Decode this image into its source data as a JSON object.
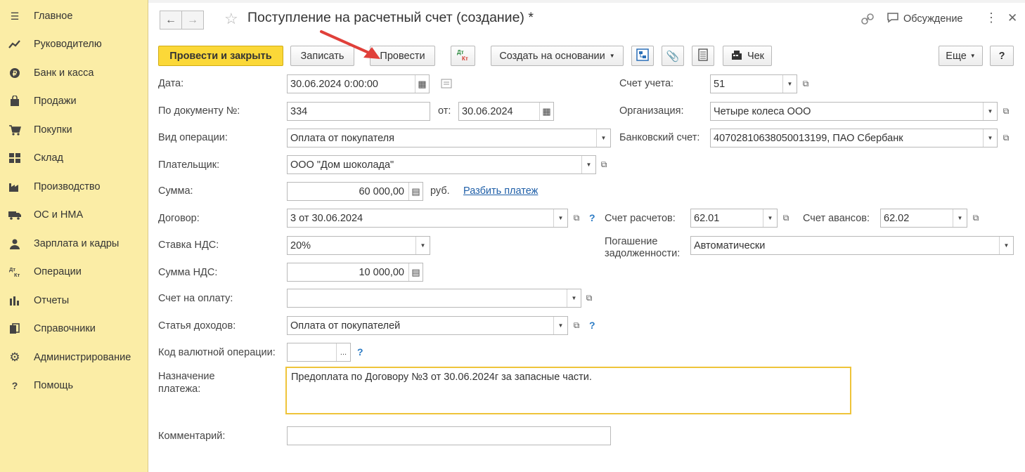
{
  "sidebar": {
    "items": [
      {
        "label": "Главное",
        "icon": "menu-icon"
      },
      {
        "label": "Руководителю",
        "icon": "trend-icon"
      },
      {
        "label": "Банк и касса",
        "icon": "coin-icon"
      },
      {
        "label": "Продажи",
        "icon": "bag-icon"
      },
      {
        "label": "Покупки",
        "icon": "cart-icon"
      },
      {
        "label": "Склад",
        "icon": "warehouse-icon"
      },
      {
        "label": "Производство",
        "icon": "factory-icon"
      },
      {
        "label": "ОС и НМА",
        "icon": "truck-icon"
      },
      {
        "label": "Зарплата и кадры",
        "icon": "person-icon"
      },
      {
        "label": "Операции",
        "icon": "dt-kt-icon"
      },
      {
        "label": "Отчеты",
        "icon": "bar-chart-icon"
      },
      {
        "label": "Справочники",
        "icon": "books-icon"
      },
      {
        "label": "Администрирование",
        "icon": "gear-icon"
      },
      {
        "label": "Помощь",
        "icon": "question-icon"
      }
    ]
  },
  "header": {
    "title": "Поступление на расчетный счет (создание) *",
    "discussion": "Обсуждение",
    "more_dots": "⋮",
    "close": "✕"
  },
  "toolbar": {
    "post_and_close": "Провести и закрыть",
    "save": "Записать",
    "post": "Провести",
    "dt_kt": "Дт Кт",
    "create_based_on": "Создать на основании",
    "receipt": "Чек",
    "more": "Еще",
    "help": "?"
  },
  "form": {
    "date_label": "Дата:",
    "date_value": "30.06.2024  0:00:00",
    "doc_number_label": "По документу №:",
    "doc_number_value": "334",
    "from_label": "от:",
    "from_value": "30.06.2024",
    "operation_label": "Вид операции:",
    "operation_value": "Оплата от покупателя",
    "payer_label": "Плательщик:",
    "payer_value": "ООО \"Дом шоколада\"",
    "amount_label": "Сумма:",
    "amount_value": "60 000,00",
    "currency": "руб.",
    "split_payment": "Разбить платеж",
    "contract_label": "Договор:",
    "contract_value": "3 от 30.06.2024",
    "vat_rate_label": "Ставка НДС:",
    "vat_rate_value": "20%",
    "vat_amount_label": "Сумма НДС:",
    "vat_amount_value": "10 000,00",
    "invoice_label": "Счет на оплату:",
    "invoice_value": "",
    "income_item_label": "Статья доходов:",
    "income_item_value": "Оплата от покупателей",
    "currency_op_label": "Код валютной операции:",
    "currency_op_value": "",
    "ellipsis": "...",
    "purpose_label": "Назначение платежа:",
    "purpose_value": "Предоплата по Договору №3 от 30.06.2024г за запасные части.",
    "comment_label": "Комментарий:",
    "comment_value": "",
    "account_label": "Счет учета:",
    "account_value": "51",
    "org_label": "Организация:",
    "org_value": "Четыре колеса ООО",
    "bank_account_label": "Банковский счет:",
    "bank_account_value": "40702810638050013199, ПАО Сбербанк",
    "settlement_account_label": "Счет расчетов:",
    "settlement_account_value": "62.01",
    "advance_account_label": "Счет авансов:",
    "advance_account_value": "62.02",
    "debt_repayment_label": "Погашение задолженности:",
    "debt_repayment_value": "Автоматически"
  },
  "annotation": {
    "arrow_color": "#e0403a"
  },
  "colors": {
    "sidebar_bg": "#fbeda6",
    "primary_button": "#fbd838",
    "focus_border": "#efc43a"
  }
}
